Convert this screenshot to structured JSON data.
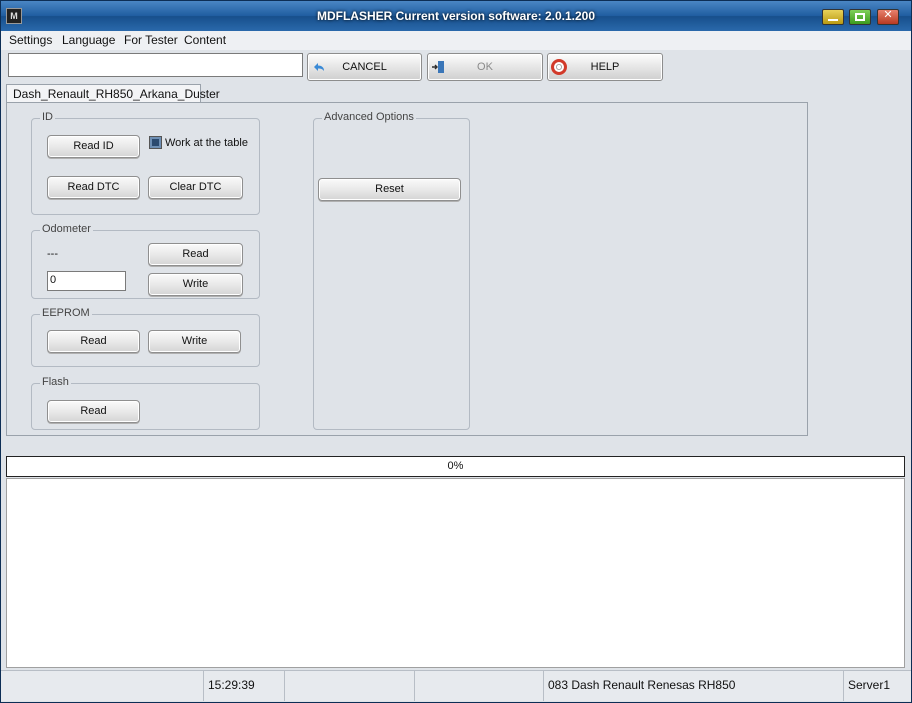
{
  "window": {
    "title": "MDFLASHER  Current version software: 2.0.1.200",
    "app_icon_text": "M"
  },
  "menu": [
    "Settings",
    "Language",
    "For Tester",
    "Content"
  ],
  "toolbar": {
    "input_value": "",
    "cancel_label": "CANCEL",
    "ok_label": "OK",
    "help_label": "HELP"
  },
  "tab": {
    "label": "Dash_Renault_RH850_Arkana_Duster"
  },
  "groups": {
    "id": {
      "title": "ID",
      "read_id": "Read ID",
      "work_at_table": "Work at the table",
      "read_dtc": "Read DTC",
      "clear_dtc": "Clear DTC"
    },
    "odometer": {
      "title": "Odometer",
      "current_value": "---",
      "input_value": "0",
      "read": "Read",
      "write": "Write"
    },
    "eeprom": {
      "title": "EEPROM",
      "read": "Read",
      "write": "Write"
    },
    "flash": {
      "title": "Flash",
      "read": "Read"
    },
    "advanced": {
      "title": "Advanced Options",
      "reset": "Reset"
    }
  },
  "progress": {
    "percent_text": "0%",
    "fraction": 0
  },
  "status": {
    "cell1": "",
    "time": "15:29:39",
    "cell3": "",
    "cell4": "",
    "device": "083 Dash Renault Renesas RH850",
    "server": "Server1"
  },
  "colors": {
    "title_bar": "#1f5da0",
    "progress_fill": "#3d7bd0"
  }
}
